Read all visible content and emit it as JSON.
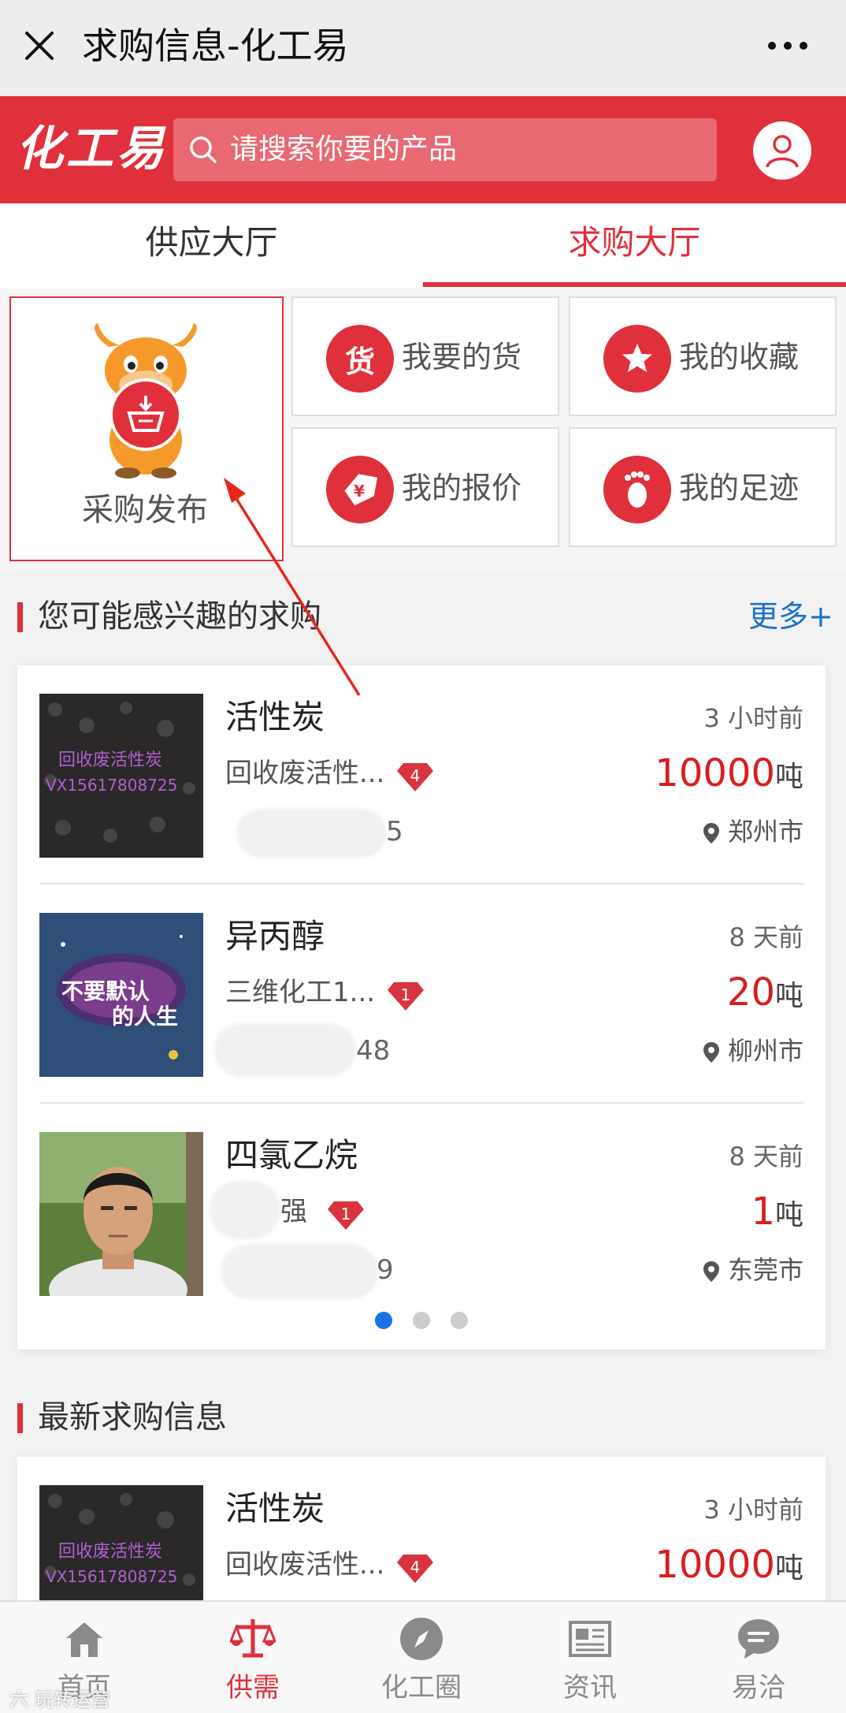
{
  "window": {
    "title": "求购信息-化工易"
  },
  "header": {
    "logo": "化工易",
    "search_placeholder": "请搜索你要的产品"
  },
  "tabs": [
    {
      "label": "供应大厅",
      "active": false
    },
    {
      "label": "求购大厅",
      "active": true
    }
  ],
  "quick": {
    "publish": "采购发布",
    "items": [
      {
        "label": "我要的货",
        "icon": "goods-icon",
        "glyph": "货"
      },
      {
        "label": "我的收藏",
        "icon": "star-icon"
      },
      {
        "label": "我的报价",
        "icon": "price-tag-icon"
      },
      {
        "label": "我的足迹",
        "icon": "footprint-icon"
      }
    ]
  },
  "interest": {
    "title": "您可能感兴趣的求购",
    "more": "更多+",
    "rows": [
      {
        "name": "活性炭",
        "time": "3 小时前",
        "company": "回收废活性...",
        "level": "4",
        "qty": "10000",
        "unit": "吨",
        "phone_visible": "5",
        "city": "郑州市",
        "thumb_text1": "回收废活性炭",
        "thumb_text2": "VX15617808725"
      },
      {
        "name": "异丙醇",
        "time": "8 天前",
        "company": "三维化工1...",
        "level": "1",
        "qty": "20",
        "unit": "吨",
        "phone_visible": "48",
        "city": "柳州市",
        "thumb_text1": "不要默认",
        "thumb_text2": "的人生"
      },
      {
        "name": "四氯乙烷",
        "time": "8 天前",
        "company": "强",
        "level": "1",
        "qty": "1",
        "unit": "吨",
        "phone_visible": "9",
        "city": "东莞市"
      }
    ],
    "pager": {
      "total": 3,
      "active": 0
    }
  },
  "latest": {
    "title": "最新求购信息",
    "rows": [
      {
        "name": "活性炭",
        "time": "3 小时前",
        "company": "回收废活性...",
        "level": "4",
        "qty": "10000",
        "unit": "吨",
        "thumb_text1": "回收废活性炭",
        "thumb_text2": "VX15617808725"
      }
    ]
  },
  "nav": [
    {
      "label": "首页",
      "icon": "home-icon",
      "active": false
    },
    {
      "label": "供需",
      "icon": "scale-icon",
      "active": true
    },
    {
      "label": "化工圈",
      "icon": "compass-icon",
      "active": false
    },
    {
      "label": "资讯",
      "icon": "news-icon",
      "active": false
    },
    {
      "label": "易洽",
      "icon": "chat-icon",
      "active": false
    }
  ],
  "watermark": "六 玩转运营",
  "colors": {
    "brand_red": "#e0303c",
    "link_blue": "#1a73c9",
    "qty_red": "#d81e1e"
  }
}
